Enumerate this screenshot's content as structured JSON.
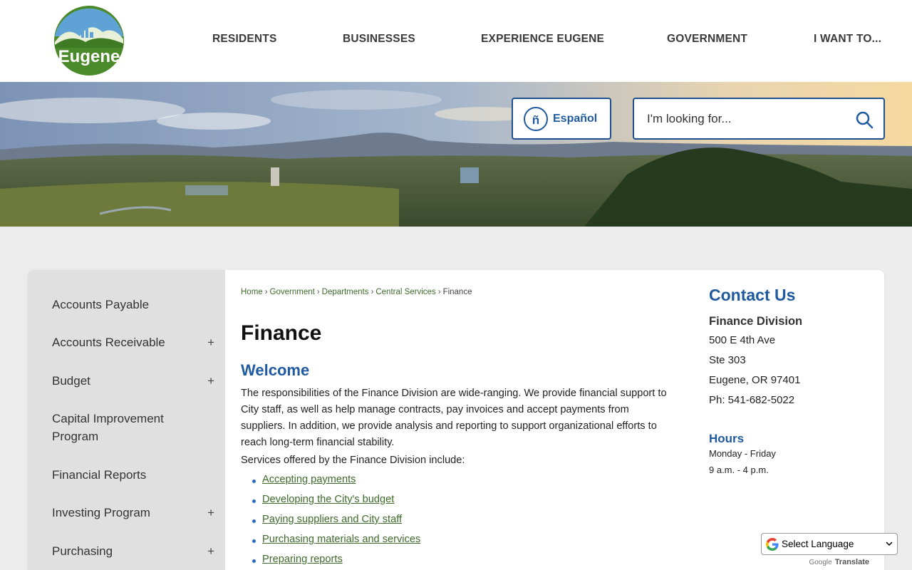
{
  "header": {
    "logo_text": "Eugene",
    "nav": [
      "RESIDENTS",
      "BUSINESSES",
      "EXPERIENCE EUGENE",
      "GOVERNMENT",
      "I WANT TO..."
    ]
  },
  "banner": {
    "espanol_label": "Español",
    "search_placeholder": "I'm looking for..."
  },
  "sidebar": {
    "items": [
      {
        "label": "Accounts Payable",
        "expandable": false
      },
      {
        "label": "Accounts Receivable",
        "expandable": true
      },
      {
        "label": "Budget",
        "expandable": true
      },
      {
        "label": "Capital Improvement Program",
        "expandable": false
      },
      {
        "label": "Financial Reports",
        "expandable": false
      },
      {
        "label": "Investing Program",
        "expandable": true
      },
      {
        "label": "Purchasing",
        "expandable": true
      }
    ],
    "expand_symbol": "+"
  },
  "breadcrumb": {
    "items": [
      "Home",
      "Government",
      "Departments",
      "Central Services"
    ],
    "current": "Finance",
    "separator": "›"
  },
  "main": {
    "title": "Finance",
    "welcome_heading": "Welcome",
    "intro": "The responsibilities of the Finance Division are wide-ranging. We provide financial support to City staff, as well as help manage contracts, pay invoices and accept payments from suppliers. In addition, we provide analysis and reporting to support organizational efforts to reach long-term financial stability.",
    "services_intro": "Services offered by the Finance Division include:",
    "services": [
      "Accepting payments",
      "Developing the City's budget",
      "Paying suppliers and City staff",
      "Purchasing materials and services",
      "Preparing reports"
    ]
  },
  "contact": {
    "title": "Contact Us",
    "org": "Finance Division",
    "address1": "500 E 4th Ave",
    "address2": "Ste 303",
    "city": "Eugene, OR 97401",
    "phone": "Ph: 541-682-5022",
    "hours_title": "Hours",
    "hours_days": "Monday - Friday",
    "hours_time": "9 a.m. -  4 p.m."
  },
  "translate": {
    "select_label": "Select Language",
    "powered_google": "Google",
    "powered_translate": "Translate"
  },
  "colors": {
    "brand_blue": "#1f5aa0",
    "link_green": "#3d6b2a",
    "logo_green": "#4a8a2a"
  }
}
